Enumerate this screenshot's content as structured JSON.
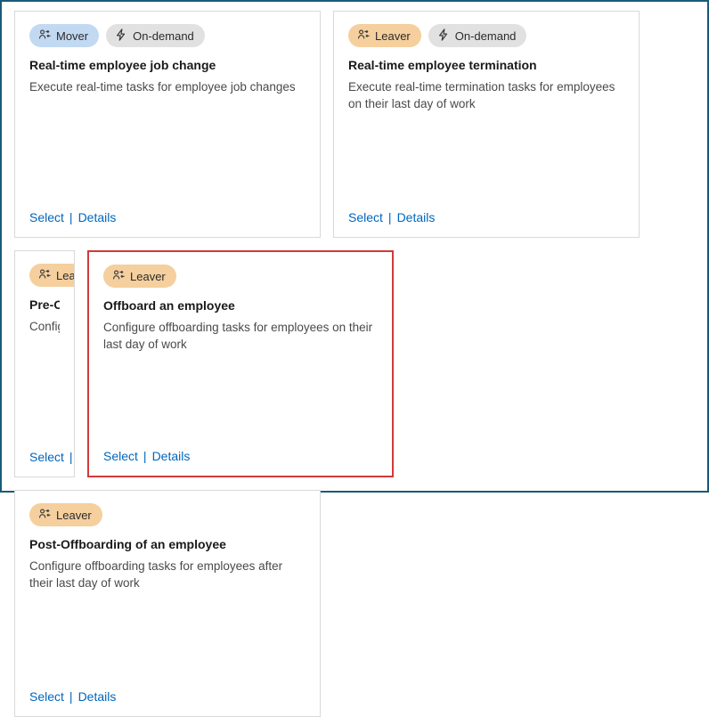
{
  "labels": {
    "mover": "Mover",
    "leaver": "Leaver",
    "ondemand": "On-demand",
    "select": "Select",
    "details": "Details"
  },
  "cards": [
    {
      "tags": [
        "mover",
        "ondemand"
      ],
      "title": "Real-time employee job change",
      "desc": "Execute real-time tasks for employee job changes",
      "highlight": false,
      "narrow": false
    },
    {
      "tags": [
        "leaver",
        "ondemand"
      ],
      "title": "Real-time employee termination",
      "desc": "Execute real-time termination tasks for employees on their last day of work",
      "highlight": false,
      "narrow": false
    },
    {
      "tags": [
        "leaver"
      ],
      "title": "Pre-Offboard",
      "desc": "Configure pre before their la",
      "highlight": false,
      "narrow": true
    },
    {
      "tags": [
        "leaver"
      ],
      "title": "Offboard an employee",
      "desc": "Configure offboarding tasks for employees on their last day of work",
      "highlight": true,
      "narrow": false
    },
    {
      "tags": [
        "leaver"
      ],
      "title": "Post-Offboarding of an employee",
      "desc": "Configure offboarding tasks for employees after their last day of work",
      "highlight": false,
      "narrow": false
    }
  ]
}
